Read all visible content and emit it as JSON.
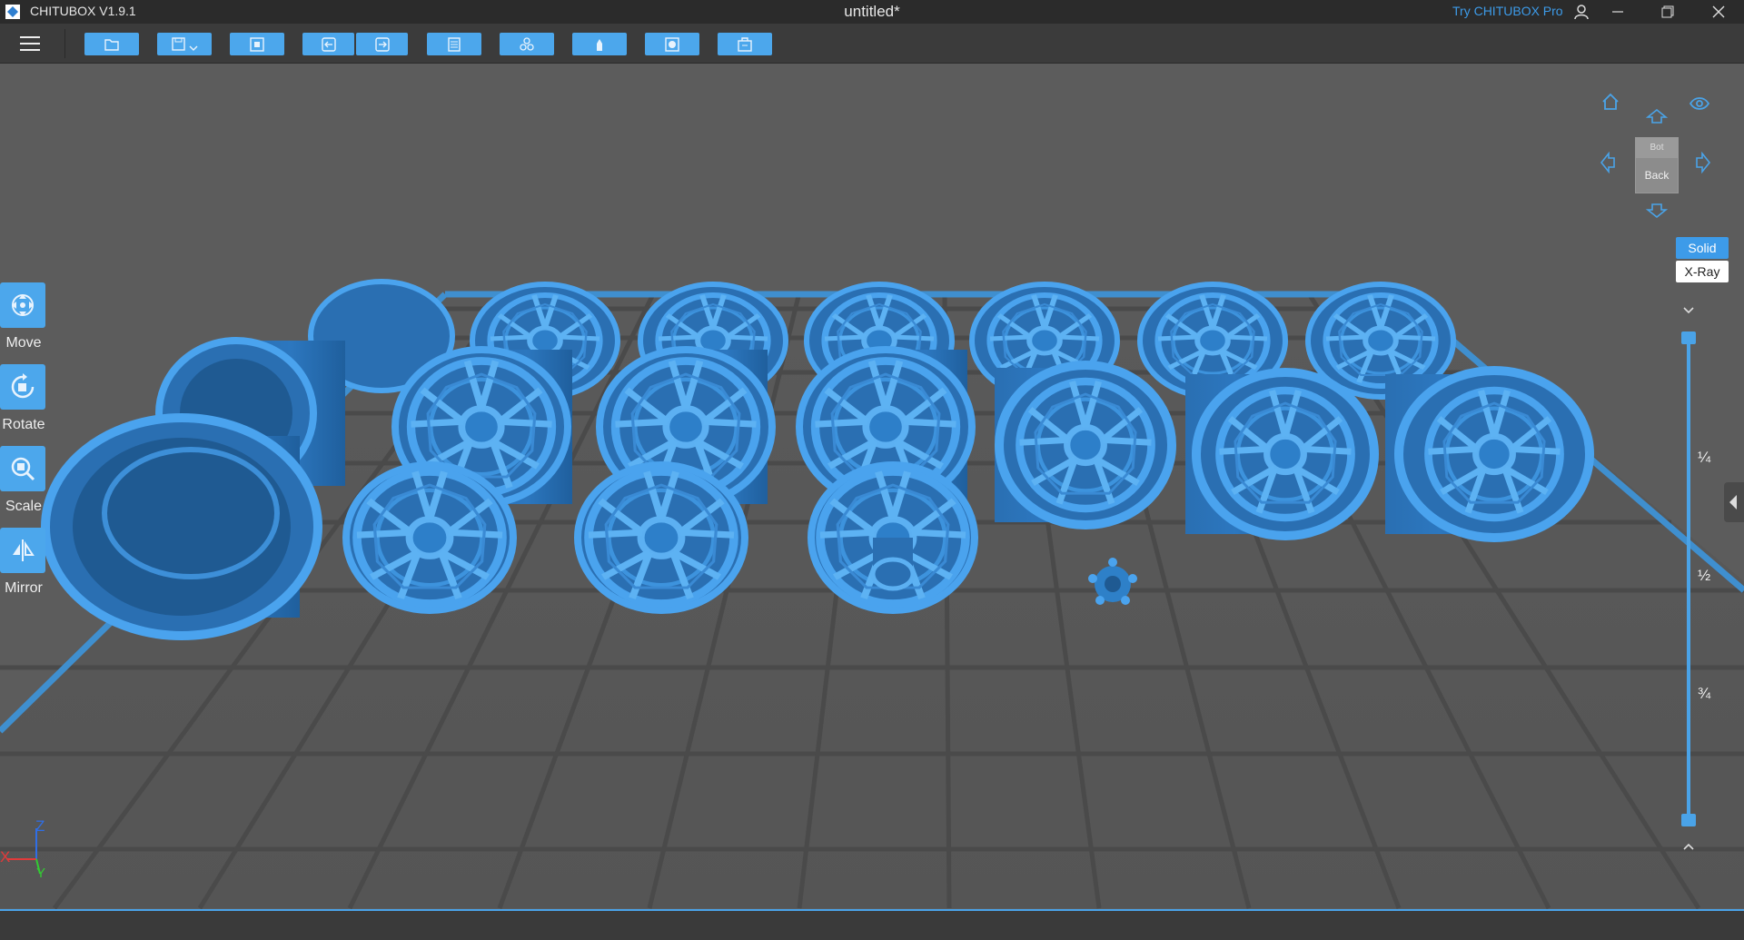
{
  "app": {
    "name": "CHITUBOX V1.9.1",
    "document_title": "untitled*",
    "try_pro": "Try CHITUBOX Pro"
  },
  "window_controls": [
    "minimize",
    "restore",
    "close"
  ],
  "toolbar": {
    "buttons": [
      {
        "name": "open-file",
        "icon": "folder-icon"
      },
      {
        "name": "save",
        "icon": "save-icon"
      },
      {
        "name": "import",
        "icon": "import-icon"
      },
      {
        "name": "undo",
        "icon": "undo-icon"
      },
      {
        "name": "redo",
        "icon": "redo-icon"
      },
      {
        "name": "layout",
        "icon": "layout-icon"
      },
      {
        "name": "arrange",
        "icon": "arrange-icon"
      },
      {
        "name": "supports",
        "icon": "supports-icon"
      },
      {
        "name": "slice-settings",
        "icon": "settings-icon"
      },
      {
        "name": "slice",
        "icon": "slice-icon"
      }
    ]
  },
  "left_tools": [
    {
      "label": "Move",
      "icon": "move-icon"
    },
    {
      "label": "Rotate",
      "icon": "rotate-icon"
    },
    {
      "label": "Scale",
      "icon": "scale-icon"
    },
    {
      "label": "Mirror",
      "icon": "mirror-icon"
    }
  ],
  "view_cube": {
    "top_label": "Bot",
    "face_label": "Back"
  },
  "render_modes": {
    "solid": "Solid",
    "xray": "X-Ray",
    "active": "Solid"
  },
  "slider": {
    "marks": [
      "¼",
      "½",
      "¾"
    ],
    "level": 1.0
  },
  "axes": {
    "x": "X",
    "y": "Y",
    "z": "Z"
  },
  "colors": {
    "accent": "#4ca7ec",
    "model": "#3d8fd8",
    "grid_edge": "#3f8fcf"
  }
}
